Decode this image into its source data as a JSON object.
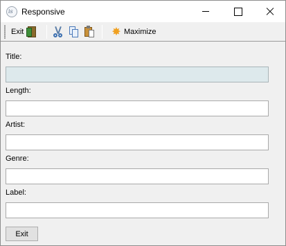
{
  "window": {
    "title": "Responsive",
    "app_icon_text": "is"
  },
  "toolbar": {
    "exit_label": "Exit",
    "maximize_label": "Maximize",
    "icons": [
      "exit-door-icon",
      "cut-icon",
      "copy-icon",
      "paste-icon",
      "maximize-star-icon"
    ]
  },
  "form": {
    "fields": [
      {
        "label": "Title:",
        "value": "",
        "disabled": true
      },
      {
        "label": "Length:",
        "value": ""
      },
      {
        "label": "Artist:",
        "value": ""
      },
      {
        "label": "Genre:",
        "value": ""
      },
      {
        "label": "Label:",
        "value": ""
      }
    ],
    "exit_button_label": "Exit"
  },
  "colors": {
    "disabled_field_bg": "#dde9ec",
    "window_bg": "#f0f0f0",
    "maximize_icon": "#f0a020"
  }
}
